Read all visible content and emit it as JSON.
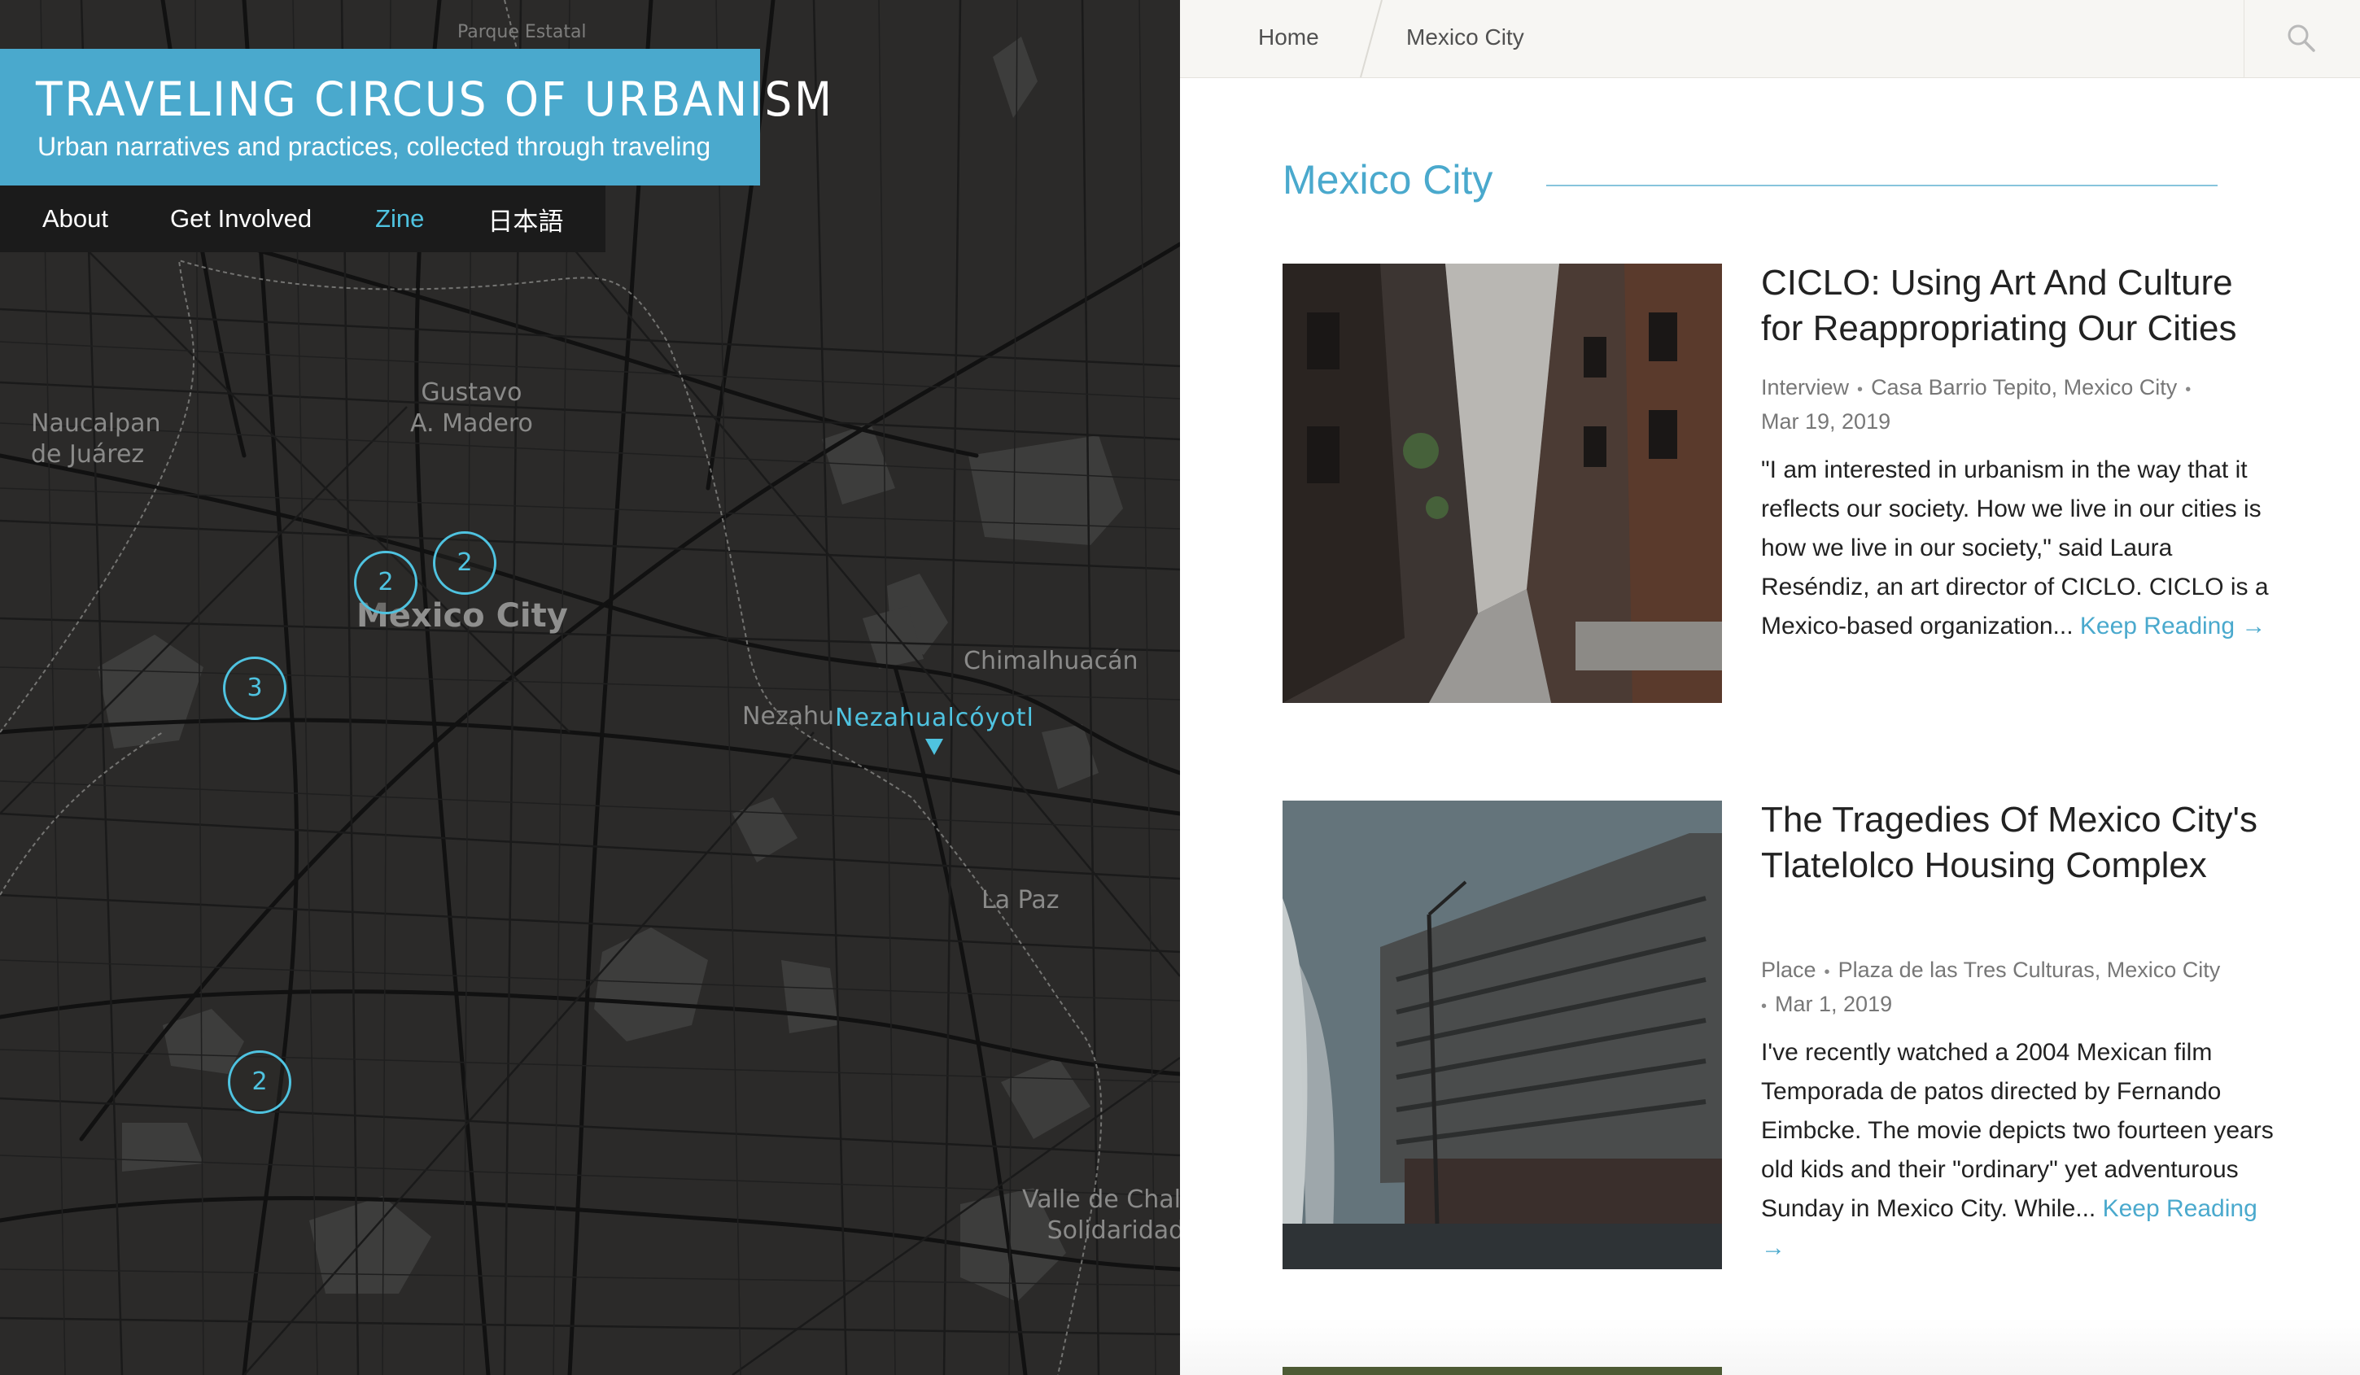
{
  "site": {
    "title": "TRAVELING CIRCUS OF URBANISM",
    "tagline": "Urban narratives and practices, collected through traveling"
  },
  "nav": {
    "items": [
      {
        "label": "About",
        "active": false
      },
      {
        "label": "Get Involved",
        "active": false
      },
      {
        "label": "Zine",
        "active": true
      },
      {
        "label": "日本語",
        "active": false
      }
    ]
  },
  "map": {
    "labels": {
      "parque_estatal": "Parque Estatal",
      "naucalpan": "Naucalpan\nde Juárez",
      "gustavo": "Gustavo\nA. Madero",
      "mexico_city": "Mexico City",
      "chimalhuacan": "Chimalhuacán",
      "nezahualcoyotl_base": "Nezahu",
      "nezahualcoyotl_highlight": "Nezahualcóyotl",
      "la_paz": "La Paz",
      "valle_chalco": "Valle de Chalco\nSolidaridad"
    },
    "clusters": [
      {
        "count": "2"
      },
      {
        "count": "2"
      },
      {
        "count": "3"
      },
      {
        "count": "2"
      }
    ],
    "accent_color": "#4fc3e0",
    "background_color": "#2b2a29"
  },
  "breadcrumb": {
    "home": "Home",
    "current": "Mexico City"
  },
  "search": {
    "icon": "search-icon"
  },
  "page": {
    "heading": "Mexico City",
    "accent_color": "#4aa9cd"
  },
  "articles": [
    {
      "title": "CICLO: Using Art And Culture for Reappropriating Our Cities",
      "category": "Interview",
      "location": "Casa Barrio Tepito, Mexico City",
      "date": "Mar 19, 2019",
      "excerpt": "\"I am interested in urbanism in the way that it reflects our society. How we live in our cities is how we live in our society,\" said Laura Reséndiz, an art director of CICLO. CICLO is a Mexico-based organization...",
      "more": "Keep Reading →"
    },
    {
      "title": "The Tragedies Of Mexico City's Tlatelolco Housing Complex",
      "category": "Place",
      "location": "Plaza de las Tres Culturas, Mexico City",
      "date": "Mar 1, 2019",
      "excerpt": "I've recently watched a 2004 Mexican film Temporada de patos directed by Fernando Eimbcke. The movie depicts two fourteen years old kids and their \"ordinary\" yet adventurous Sunday in Mexico City. While...",
      "more": "Keep Reading →"
    }
  ]
}
